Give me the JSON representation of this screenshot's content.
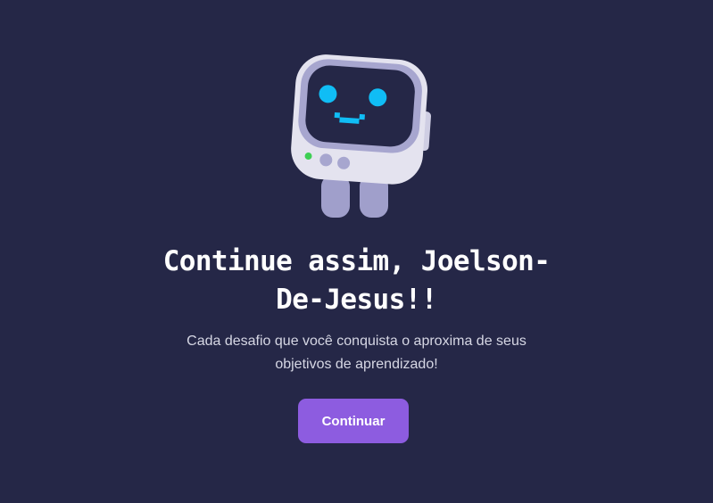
{
  "mascot": {
    "name": "robot-mascot",
    "colors": {
      "body": "#e4e3ef",
      "screen_frame": "#a7a6cf",
      "screen": "#252747",
      "eyes": "#10bdf5",
      "legs": "#a09fcb",
      "led": "#3ecf54"
    }
  },
  "message": {
    "title_line1": "Continue assim, Joelson-",
    "title_line2": "De-Jesus!!",
    "subtitle_line1": "Cada desafio que você conquista o aproxima de seus",
    "subtitle_line2": "objetivos de aprendizado!"
  },
  "actions": {
    "continue_label": "Continuar"
  },
  "theme": {
    "background": "#252747",
    "accent": "#8d5ce0"
  }
}
